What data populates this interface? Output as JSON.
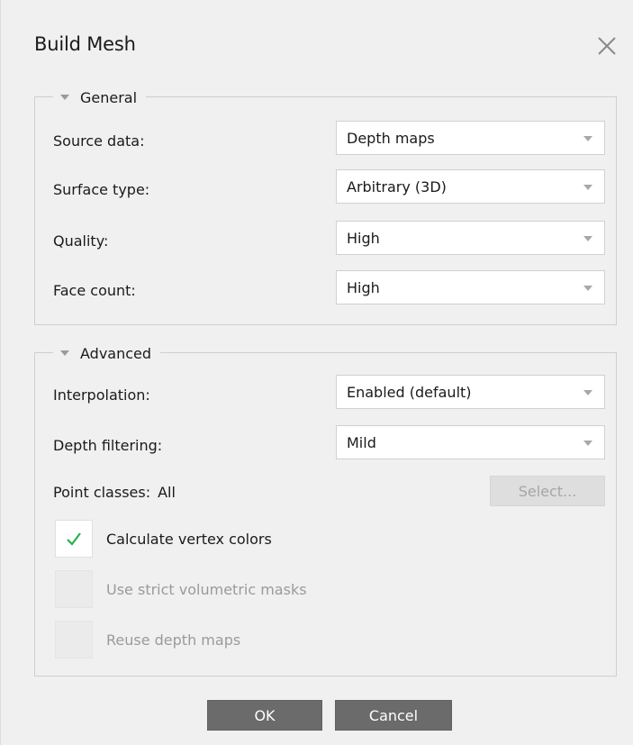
{
  "window": {
    "title": "Build Mesh",
    "close_icon": "close-icon"
  },
  "general": {
    "legend": "General",
    "rows": [
      {
        "label": "Source data:",
        "value": "Depth maps"
      },
      {
        "label": "Surface type:",
        "value": "Arbitrary (3D)"
      },
      {
        "label": "Quality:",
        "value": "High"
      },
      {
        "label": "Face count:",
        "value": "High"
      }
    ]
  },
  "advanced": {
    "legend": "Advanced",
    "rows": [
      {
        "label": "Interpolation:",
        "value": "Enabled (default)"
      },
      {
        "label": "Depth filtering:",
        "value": "Mild"
      }
    ],
    "point_classes": {
      "label": "Point classes:",
      "value": "All",
      "button_label": "Select..."
    },
    "checkboxes": [
      {
        "label": "Calculate vertex colors",
        "checked": true,
        "enabled": true
      },
      {
        "label": "Use strict volumetric masks",
        "checked": false,
        "enabled": false
      },
      {
        "label": "Reuse depth maps",
        "checked": false,
        "enabled": false
      }
    ]
  },
  "buttons": {
    "ok": "OK",
    "cancel": "Cancel"
  },
  "colors": {
    "dialog_bg": "#f0f0f0",
    "check_green": "#22b14c",
    "button_bg": "#6b6b6b",
    "disabled_text": "#9a9a9a"
  }
}
